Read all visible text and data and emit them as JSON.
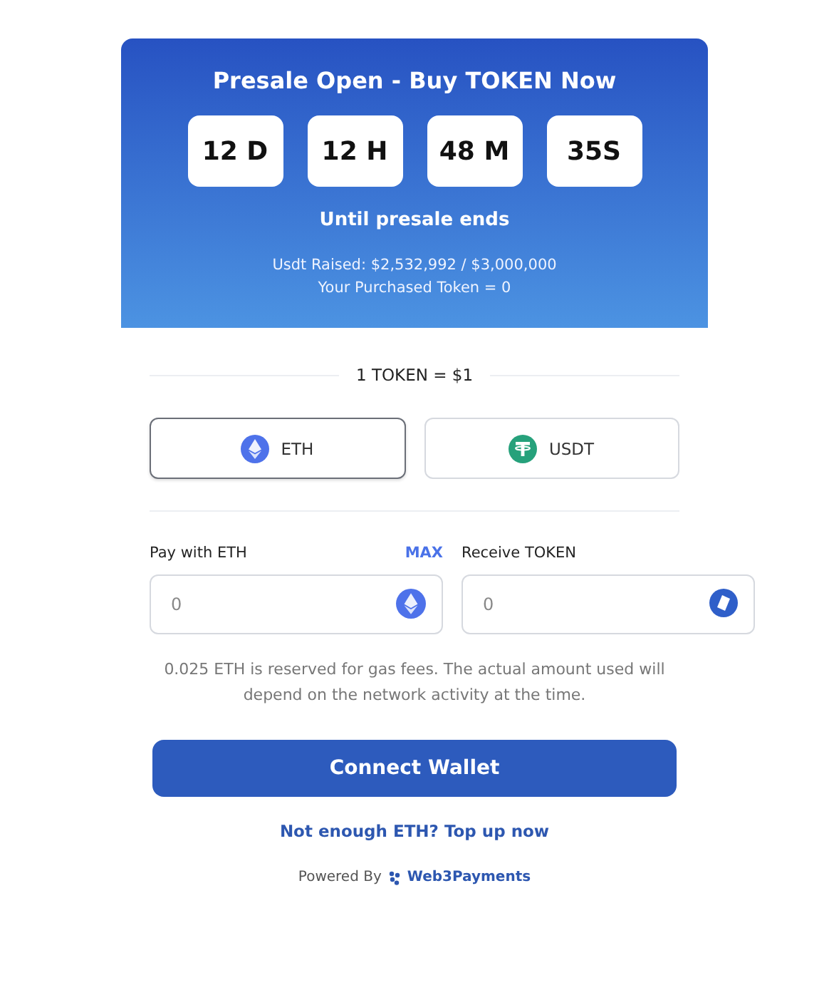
{
  "header": {
    "title": "Presale Open - Buy TOKEN Now",
    "countdown": [
      "12 D",
      "12 H",
      "48 M",
      "35S"
    ],
    "subtitle": "Until presale ends",
    "raised": "Usdt Raised: $2,532,992 / $3,000,000",
    "purchased": "Your Purchased Token = 0"
  },
  "price": "1 TOKEN = $1",
  "currencies": [
    {
      "label": "ETH",
      "kind": "eth",
      "selected": true
    },
    {
      "label": "USDT",
      "kind": "usdt",
      "selected": false
    }
  ],
  "pay": {
    "label": "Pay with ETH",
    "max": "MAX",
    "placeholder": "0"
  },
  "receive": {
    "label": "Receive TOKEN",
    "placeholder": "0"
  },
  "note": "0.025 ETH is reserved for gas fees. The actual amount used will depend on the network activity at the time.",
  "connect": "Connect Wallet",
  "topup": "Not enough ETH? Top up now",
  "powered": {
    "label": "Powered By",
    "brand": "Web3Payments"
  }
}
